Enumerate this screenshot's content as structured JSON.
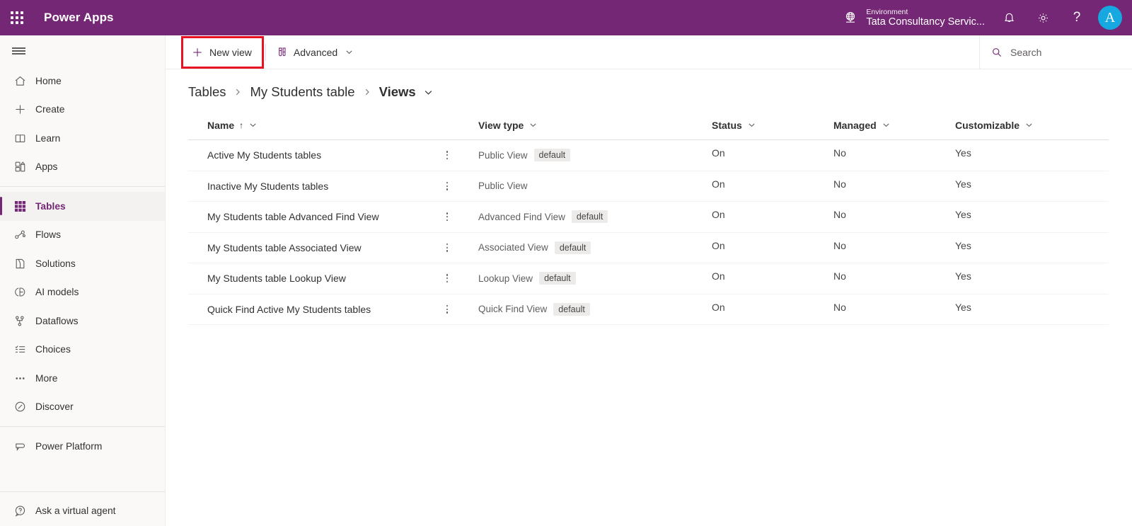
{
  "topbar": {
    "waffle_icon": "app-launcher-waffle-icon",
    "brand": "Power Apps",
    "environment_label": "Environment",
    "environment_name": "Tata Consultancy Servic...",
    "environment_icon": "globe-environment-icon",
    "notification_icon": "bell-icon",
    "settings_icon": "gear-icon",
    "help_icon": "question-mark-icon",
    "help_glyph": "?",
    "avatar_initial": "A",
    "brand_color": "#742774",
    "avatar_color": "#16a8e0"
  },
  "sidebar": {
    "hamburger_icon": "hamburger-menu-icon",
    "items": [
      {
        "label": "Home",
        "icon": "home-icon",
        "active": false
      },
      {
        "label": "Create",
        "icon": "plus-icon",
        "active": false
      },
      {
        "label": "Learn",
        "icon": "book-icon",
        "active": false
      },
      {
        "label": "Apps",
        "icon": "apps-grid-icon",
        "active": false
      },
      {
        "label": "Tables",
        "icon": "tables-grid-icon",
        "active": true
      },
      {
        "label": "Flows",
        "icon": "flows-nodes-icon",
        "active": false
      },
      {
        "label": "Solutions",
        "icon": "solutions-box-icon",
        "active": false
      },
      {
        "label": "AI models",
        "icon": "ai-brain-icon",
        "active": false
      },
      {
        "label": "Dataflows",
        "icon": "dataflows-icon",
        "active": false
      },
      {
        "label": "Choices",
        "icon": "checklist-icon",
        "active": false
      },
      {
        "label": "More",
        "icon": "ellipsis-icon",
        "active": false
      },
      {
        "label": "Discover",
        "icon": "compass-icon",
        "active": false
      },
      {
        "label": "Power Platform",
        "icon": "power-platform-icon",
        "active": false
      },
      {
        "label": "Ask a virtual agent",
        "icon": "question-chat-icon",
        "active": false
      }
    ],
    "accent_color": "#742774"
  },
  "commandbar": {
    "new_view_label": "New view",
    "new_view_icon": "plus-icon",
    "advanced_label": "Advanced",
    "advanced_icon": "test-tubes-icon",
    "advanced_chevron_icon": "chevron-down-icon",
    "highlight_color": "#e81123",
    "search_icon": "search-icon",
    "search_placeholder": "Search",
    "search_value": ""
  },
  "breadcrumb": {
    "items": [
      "Tables",
      "My Students table",
      "Views"
    ],
    "separator_icon": "chevron-right-icon",
    "dropdown_icon": "chevron-down-icon"
  },
  "table": {
    "columns": [
      {
        "label": "Name",
        "sorted": true,
        "sort_glyph": "↑"
      },
      {
        "label": "View type",
        "sorted": false,
        "sort_glyph": ""
      },
      {
        "label": "Status",
        "sorted": false,
        "sort_glyph": ""
      },
      {
        "label": "Managed",
        "sorted": false,
        "sort_glyph": ""
      },
      {
        "label": "Customizable",
        "sorted": false,
        "sort_glyph": ""
      }
    ],
    "column_chevron_icon": "chevron-down-icon",
    "row_menu_icon": "kebab-menu-icon",
    "default_badge": "default",
    "rows": [
      {
        "name": "Active My Students tables",
        "view_type": "Public View",
        "is_default": true,
        "status": "On",
        "managed": "No",
        "customizable": "Yes"
      },
      {
        "name": "Inactive My Students tables",
        "view_type": "Public View",
        "is_default": false,
        "status": "On",
        "managed": "No",
        "customizable": "Yes"
      },
      {
        "name": "My Students table Advanced Find View",
        "view_type": "Advanced Find View",
        "is_default": true,
        "status": "On",
        "managed": "No",
        "customizable": "Yes"
      },
      {
        "name": "My Students table Associated View",
        "view_type": "Associated View",
        "is_default": true,
        "status": "On",
        "managed": "No",
        "customizable": "Yes"
      },
      {
        "name": "My Students table Lookup View",
        "view_type": "Lookup View",
        "is_default": true,
        "status": "On",
        "managed": "No",
        "customizable": "Yes"
      },
      {
        "name": "Quick Find Active My Students tables",
        "view_type": "Quick Find View",
        "is_default": true,
        "status": "On",
        "managed": "No",
        "customizable": "Yes"
      }
    ]
  }
}
